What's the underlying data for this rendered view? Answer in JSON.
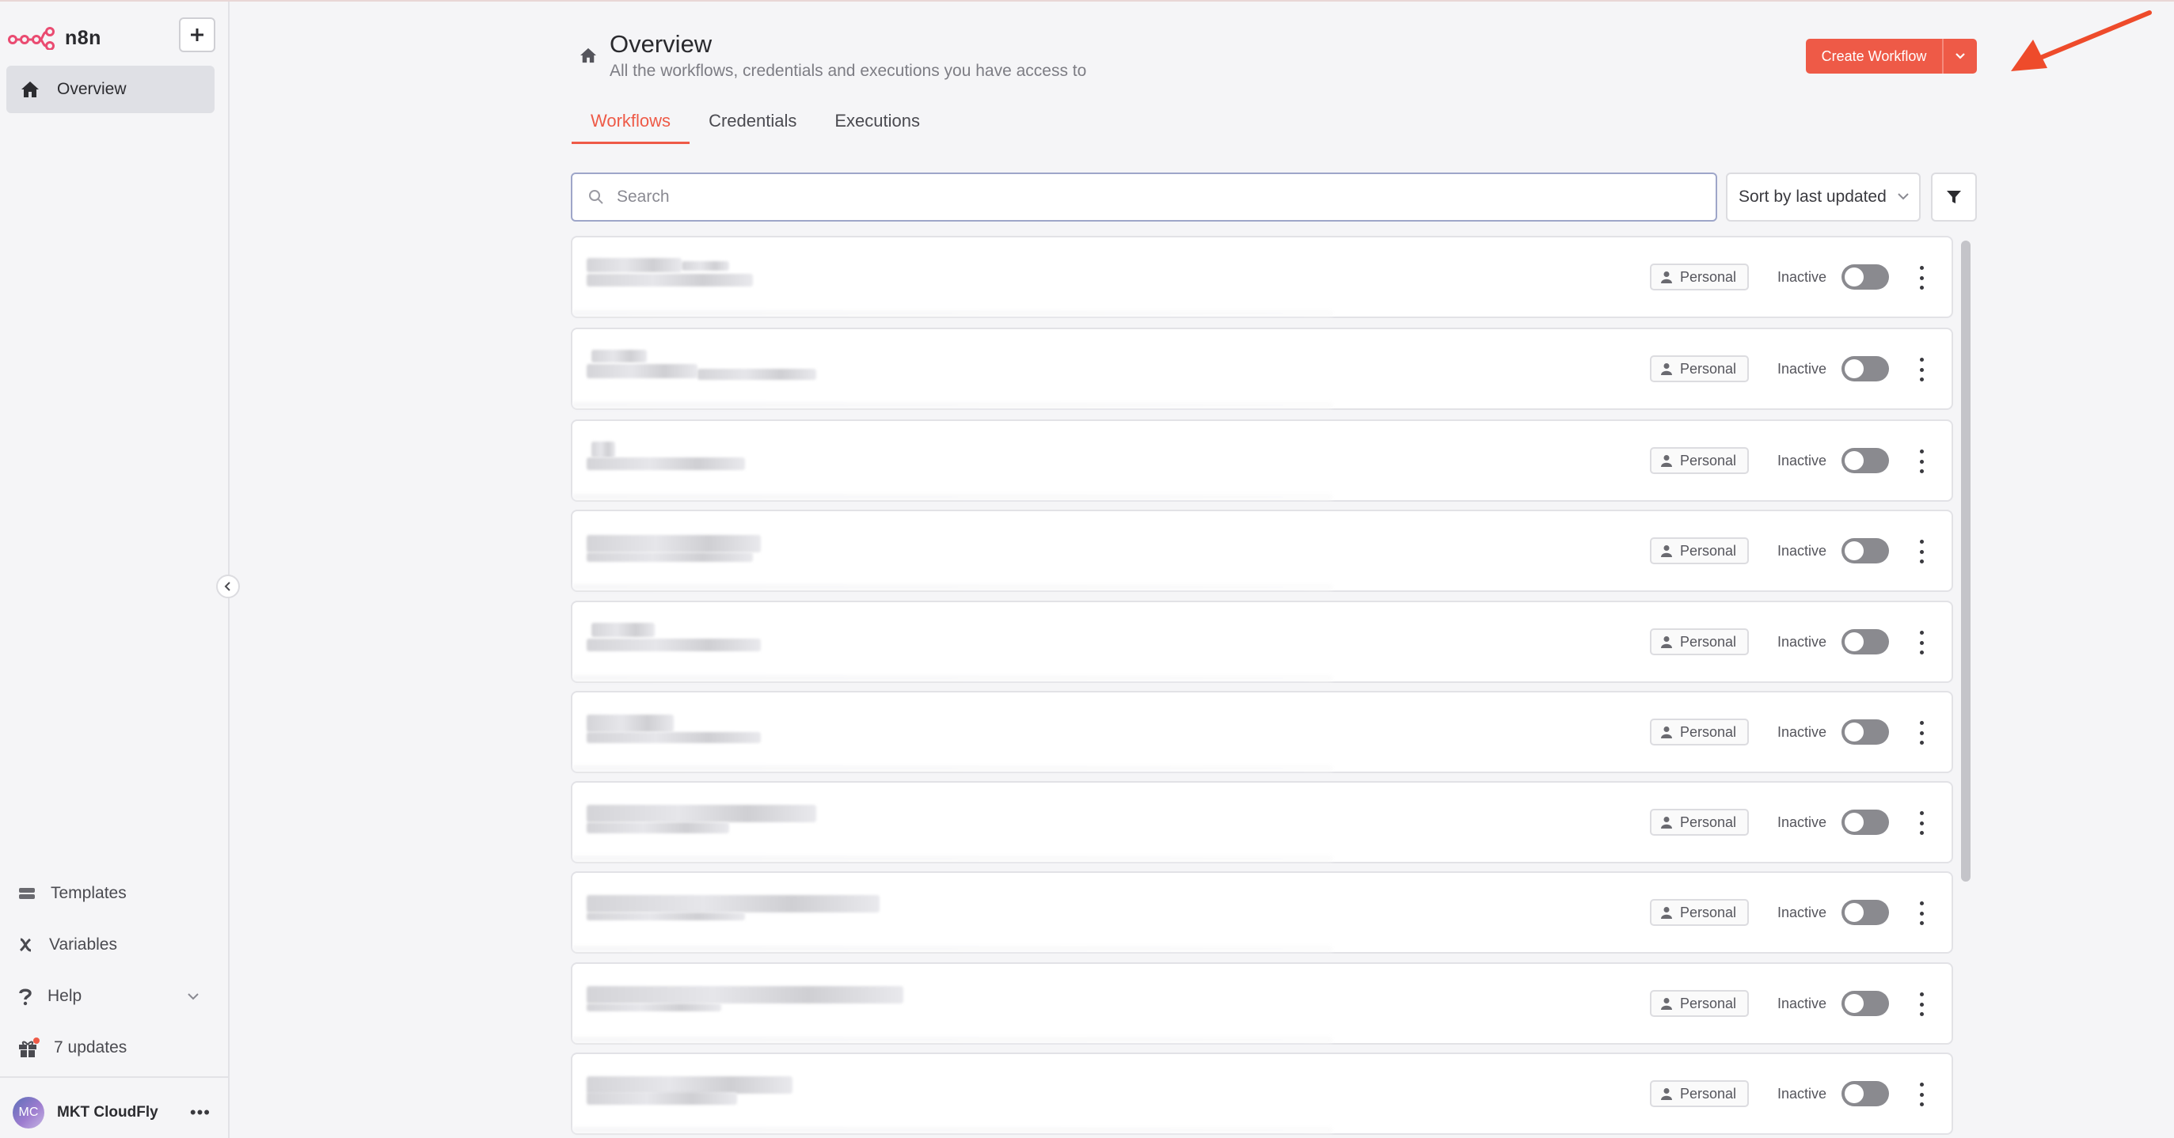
{
  "app": {
    "name": "n8n"
  },
  "colors": {
    "accent": "#ee5a47",
    "sidebar_active": "#dfe0e5",
    "toggle_off": "#8a8a8f"
  },
  "sidebar": {
    "overview_label": "Overview",
    "templates_label": "Templates",
    "variables_label": "Variables",
    "help_label": "Help",
    "updates_label": "7 updates",
    "user": {
      "initials": "MC",
      "name": "MKT CloudFly"
    }
  },
  "header": {
    "title": "Overview",
    "subtitle": "All the workflows, credentials and executions you have access to",
    "create_label": "Create Workflow"
  },
  "tabs": [
    {
      "label": "Workflows",
      "active": true
    },
    {
      "label": "Credentials",
      "active": false
    },
    {
      "label": "Executions",
      "active": false
    }
  ],
  "toolbar": {
    "search_placeholder": "Search",
    "sort_label": "Sort by last updated"
  },
  "workflows": [
    {
      "project": "Personal",
      "status": "Inactive"
    },
    {
      "project": "Personal",
      "status": "Inactive"
    },
    {
      "project": "Personal",
      "status": "Inactive"
    },
    {
      "project": "Personal",
      "status": "Inactive"
    },
    {
      "project": "Personal",
      "status": "Inactive"
    },
    {
      "project": "Personal",
      "status": "Inactive"
    },
    {
      "project": "Personal",
      "status": "Inactive"
    },
    {
      "project": "Personal",
      "status": "Inactive"
    },
    {
      "project": "Personal",
      "status": "Inactive"
    },
    {
      "project": "Personal",
      "status": "Inactive"
    }
  ]
}
